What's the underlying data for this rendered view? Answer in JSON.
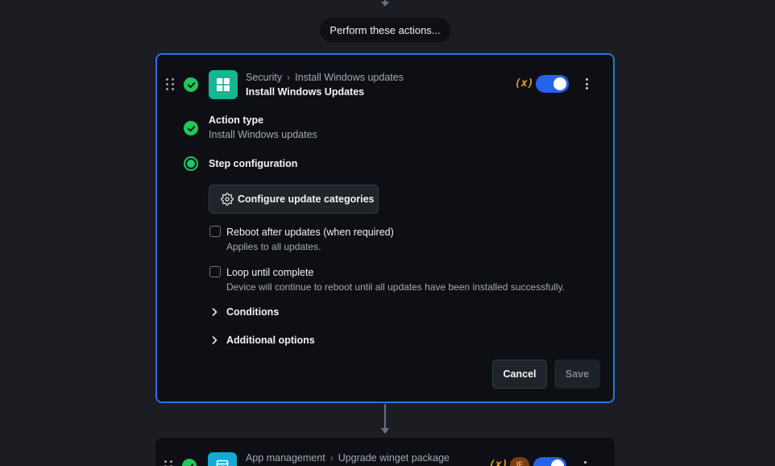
{
  "flow": {
    "perform_label": "Perform these actions..."
  },
  "step1": {
    "breadcrumb_category": "Security",
    "breadcrumb_action": "Install Windows updates",
    "title": "Install Windows Updates",
    "variable_icon": "(x)",
    "enabled": true,
    "action_type_label": "Action type",
    "action_type_value": "Install Windows updates",
    "step_config_label": "Step configuration",
    "configure_button": "Configure update categories",
    "options": [
      {
        "label": "Reboot after updates (when required)",
        "description": "Applies to all updates.",
        "checked": false
      },
      {
        "label": "Loop until complete",
        "description": "Device will continue to reboot until all updates have been installed successfully.",
        "checked": false
      }
    ],
    "conditions_label": "Conditions",
    "additional_options_label": "Additional options",
    "cancel_label": "Cancel",
    "save_label": "Save"
  },
  "step2": {
    "breadcrumb_category": "App management",
    "breadcrumb_action": "Upgrade winget package",
    "variable_icon": "(x)",
    "if_badge": "IF",
    "enabled": true
  },
  "colors": {
    "background": "#1b1d22",
    "card": "#0d0f14",
    "accent_blue": "#2f6fe4",
    "success_green": "#22c55e",
    "variable_orange": "#e7a11b",
    "windows_icon_bg": "#18b493",
    "winget_icon_bg": "#15a9d6"
  },
  "icons": {
    "drag": "drag-handle-icon",
    "check": "check-circle-icon",
    "windows": "windows-logo-icon",
    "gear": "gear-icon",
    "chevron": "chevron-right-icon",
    "kebab": "more-vertical-icon",
    "package": "package-icon"
  }
}
